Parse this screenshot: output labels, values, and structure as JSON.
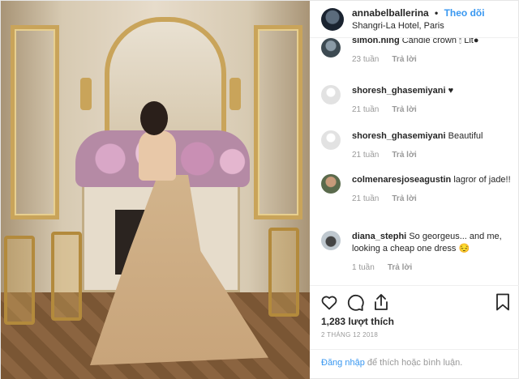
{
  "post": {
    "username": "annabelballerina",
    "separator": "•",
    "follow_label": "Theo dõi",
    "location": "Shangri-La Hotel, Paris"
  },
  "comments": [
    {
      "user": "simon.hing",
      "text": "Candle crown 🕯 Lit●",
      "age": "23 tuần",
      "reply": "Trả lời"
    },
    {
      "user": "shoresh_ghasemiyani",
      "text": "♥",
      "age": "21 tuần",
      "reply": "Trả lời"
    },
    {
      "user": "shoresh_ghasemiyani",
      "text": "Beautiful",
      "age": "21 tuần",
      "reply": "Trả lời"
    },
    {
      "user": "colmenaresjoseagustin",
      "text": "lagror of jade!!",
      "age": "21 tuần",
      "reply": "Trả lời"
    },
    {
      "user": "diana_stephi",
      "text": "So georgeus... and me, looking a cheap one dress 😔",
      "age": "1 tuần",
      "reply": "Trả lời"
    }
  ],
  "actions": {
    "icons": [
      "heart-icon",
      "comment-icon",
      "share-icon",
      "bookmark-icon"
    ],
    "likes": "1,283 lượt thích",
    "date": "2 THÁNG 12 2018",
    "login_link": "Đăng nhập",
    "login_text": " để thích hoặc bình luận."
  },
  "colors": {
    "link": "#3897f0",
    "muted": "#999999",
    "text": "#262626"
  }
}
